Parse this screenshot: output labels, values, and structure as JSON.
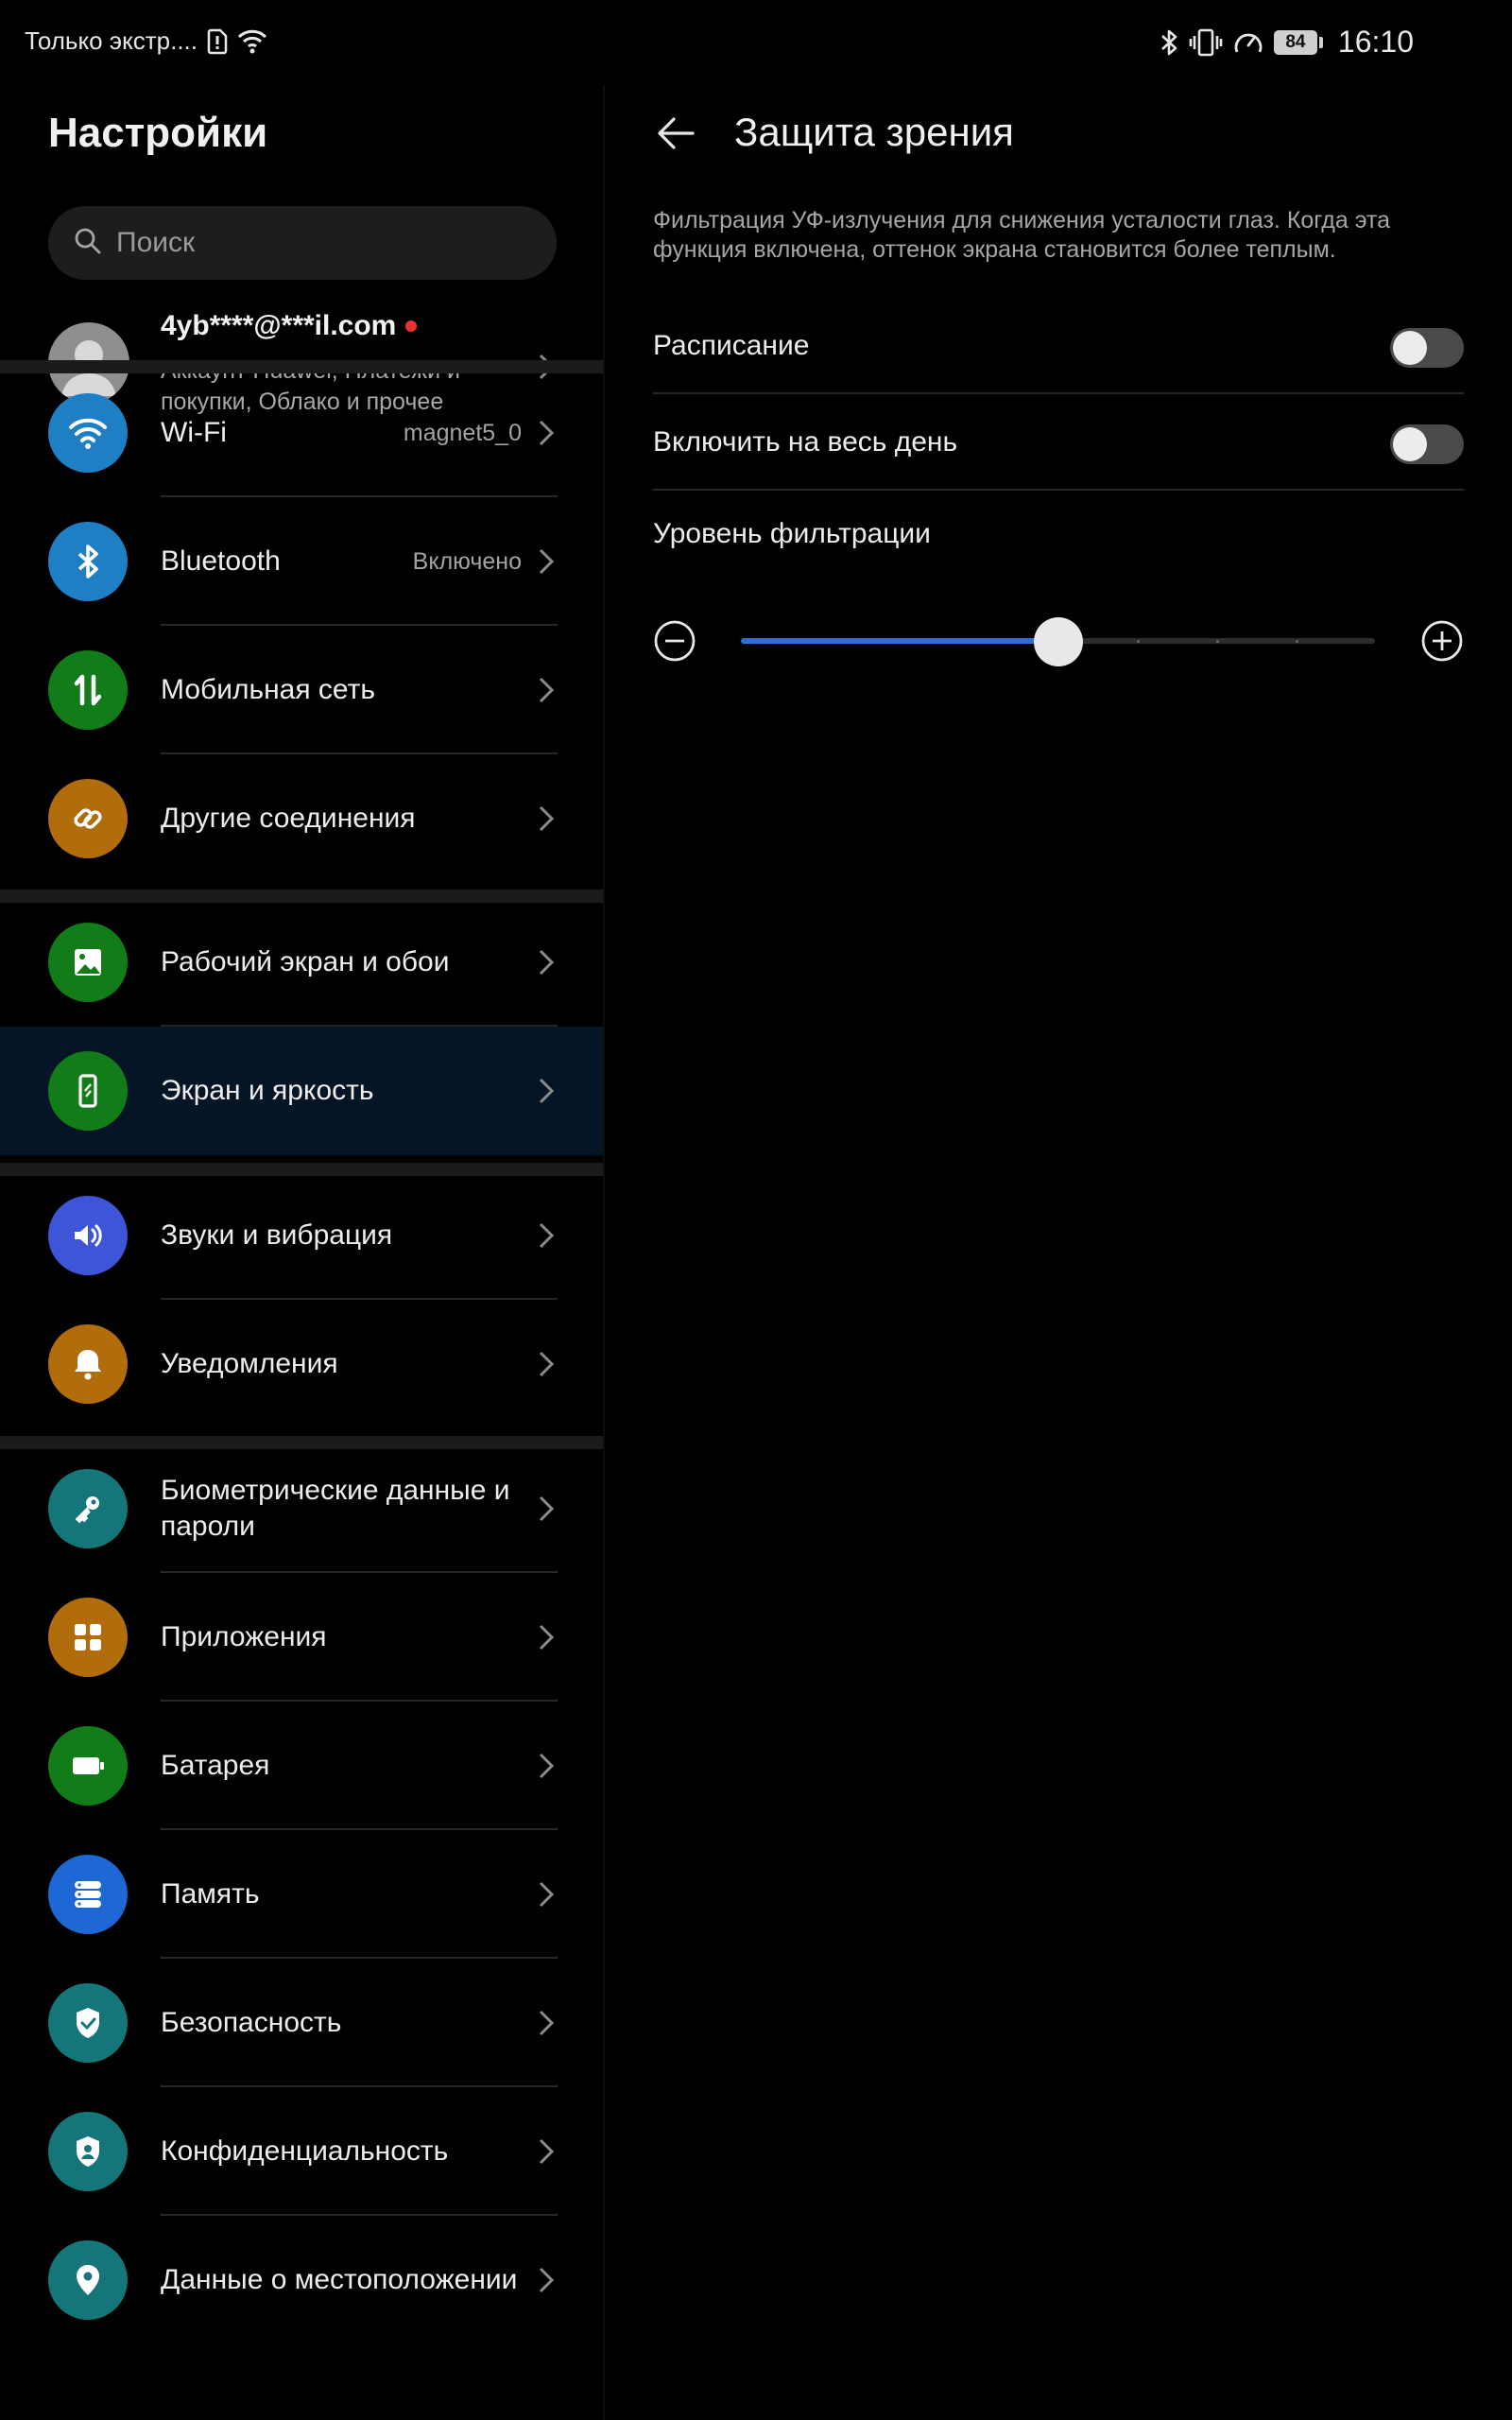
{
  "status_bar": {
    "carrier": "Только экстр....",
    "battery": "84",
    "time": "16:10"
  },
  "left_panel": {
    "title": "Настройки",
    "search_placeholder": "Поиск",
    "account": {
      "email": "4yb****@***il.com",
      "subtitle": "Аккаунт Huawei, Платежи и покупки, Облако и прочее"
    },
    "items": [
      {
        "label": "Wi-Fi",
        "value": "magnet5_0",
        "icon": "wifi-icon",
        "color": "#1f7fc4"
      },
      {
        "label": "Bluetooth",
        "value": "Включено",
        "icon": "bluetooth-icon",
        "color": "#1f7fc4"
      },
      {
        "label": "Мобильная сеть",
        "value": "",
        "icon": "mobile-data-icon",
        "color": "#127c18"
      },
      {
        "label": "Другие соединения",
        "value": "",
        "icon": "link-icon",
        "color": "#b16c0c"
      },
      {
        "label": "Рабочий экран и обои",
        "value": "",
        "icon": "wallpaper-icon",
        "color": "#127c18"
      },
      {
        "label": "Экран и яркость",
        "value": "",
        "icon": "display-icon",
        "color": "#127c18"
      },
      {
        "label": "Звуки и вибрация",
        "value": "",
        "icon": "sound-icon",
        "color": "#3e55d8"
      },
      {
        "label": "Уведомления",
        "value": "",
        "icon": "bell-icon",
        "color": "#b16c0c"
      },
      {
        "label": "Биометрические данные и пароли",
        "value": "",
        "icon": "key-icon",
        "color": "#14767a"
      },
      {
        "label": "Приложения",
        "value": "",
        "icon": "apps-icon",
        "color": "#b16c0c"
      },
      {
        "label": "Батарея",
        "value": "",
        "icon": "battery-icon",
        "color": "#127c18"
      },
      {
        "label": "Память",
        "value": "",
        "icon": "storage-icon",
        "color": "#1d68d4"
      },
      {
        "label": "Безопасность",
        "value": "",
        "icon": "shield-icon",
        "color": "#14767a"
      },
      {
        "label": "Конфиденциальность",
        "value": "",
        "icon": "privacy-icon",
        "color": "#14767a"
      },
      {
        "label": "Данные о местоположении",
        "value": "",
        "icon": "location-icon",
        "color": "#14767a"
      }
    ],
    "active_item": "Экран и яркость"
  },
  "right_panel": {
    "title": "Защита зрения",
    "description": "Фильтрация УФ-излучения для снижения усталости глаз. Когда эта функция включена, оттенок экрана становится более теплым.",
    "schedule_label": "Расписание",
    "schedule_on": false,
    "all_day_label": "Включить на весь день",
    "all_day_on": false,
    "level_label": "Уровень фильтрации",
    "level_fraction": 0.5,
    "accent": "#2e6fdc"
  }
}
